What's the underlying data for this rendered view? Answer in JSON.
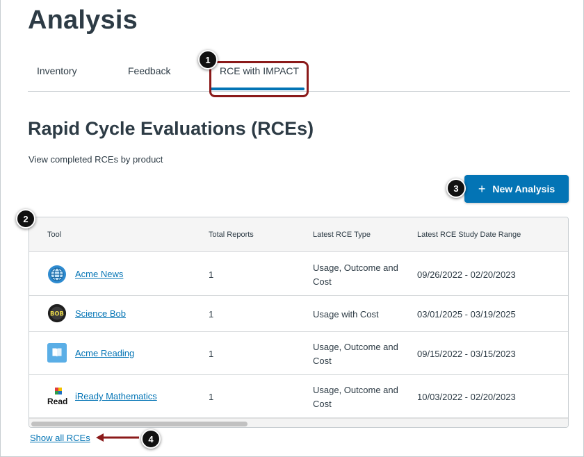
{
  "page": {
    "title": "Analysis"
  },
  "tabs": [
    {
      "label": "Inventory"
    },
    {
      "label": "Feedback"
    },
    {
      "label": "RCE with IMPACT",
      "active": true
    }
  ],
  "section": {
    "title": "Rapid Cycle Evaluations (RCEs)",
    "subtitle": "View completed RCEs by product"
  },
  "new_button": {
    "icon": "plus-icon",
    "label": "New Analysis"
  },
  "table": {
    "columns": [
      "Tool",
      "Total Reports",
      "Latest RCE Type",
      "Latest RCE Study Date Range"
    ],
    "rows": [
      {
        "icon": "globe-icon",
        "tool": "Acme News",
        "total": "1",
        "type": "Usage, Outcome and Cost",
        "dates": "09/26/2022 - 02/20/2023"
      },
      {
        "icon": "science-bob-logo",
        "tool": "Science Bob",
        "total": "1",
        "type": "Usage with Cost",
        "dates": "03/01/2025 - 03/19/2025"
      },
      {
        "icon": "book-icon",
        "tool": "Acme Reading",
        "total": "1",
        "type": "Usage, Outcome and Cost",
        "dates": "09/15/2022 - 03/15/2023"
      },
      {
        "icon": "iready-logo",
        "tool": "iReady Mathematics",
        "total": "1",
        "type": "Usage, Outcome and Cost",
        "dates": "10/03/2022 - 02/20/2023"
      }
    ],
    "logo_text": {
      "science_bob": "BOB",
      "iready": "Read"
    }
  },
  "show_all": {
    "label": "Show all RCEs"
  },
  "callouts": [
    "1",
    "2",
    "3",
    "4"
  ],
  "colors": {
    "accent": "#0374b5",
    "callout_border": "#8b1a1a",
    "text": "#2d3b45"
  }
}
